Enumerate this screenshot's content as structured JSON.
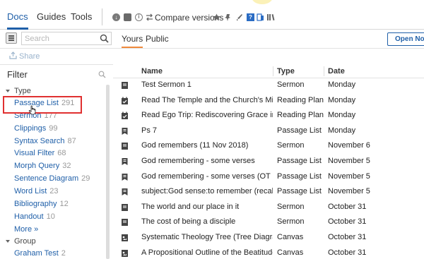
{
  "top_tabs": [
    {
      "label": "Docs",
      "active": true
    },
    {
      "label": "Guides",
      "active": false
    },
    {
      "label": "Tools",
      "active": false
    }
  ],
  "toolbar": {
    "compare_label": "Compare versions",
    "icons": [
      "download-icon",
      "panel-icon",
      "info-icon",
      "compare-icon",
      "star-icon",
      "pin-icon",
      "brush-icon",
      "help-icon",
      "bookmark-icon",
      "library-icon"
    ]
  },
  "search": {
    "placeholder": "Search",
    "value": ""
  },
  "sub_tabs": [
    {
      "label": "Yours",
      "active": true
    },
    {
      "label": "Public",
      "active": false
    }
  ],
  "open_notes_label": "Open Notes",
  "share_label": "Share",
  "filter": {
    "title": "Filter",
    "type_group_label": "Type",
    "type_items": [
      {
        "label": "Passage List",
        "count": "291"
      },
      {
        "label": "Sermon",
        "count": "177"
      },
      {
        "label": "Clippings",
        "count": "99"
      },
      {
        "label": "Syntax Search",
        "count": "87"
      },
      {
        "label": "Visual Filter",
        "count": "68"
      },
      {
        "label": "Morph Query",
        "count": "32"
      },
      {
        "label": "Sentence Diagram",
        "count": "29"
      },
      {
        "label": "Word List",
        "count": "23"
      },
      {
        "label": "Bibliography",
        "count": "12"
      },
      {
        "label": "Handout",
        "count": "10"
      }
    ],
    "more_label": "More »",
    "group_label": "Group",
    "group_items": [
      {
        "label": "Graham Test",
        "count": "2"
      }
    ]
  },
  "table": {
    "columns": [
      "Name",
      "Type",
      "Date"
    ],
    "rows": [
      {
        "icon": "sermon-icon",
        "name": "Test Sermon 1",
        "type": "Sermon",
        "date": "Monday"
      },
      {
        "icon": "reading-plan-icon",
        "name": "Read The Temple and the Church's Missi...",
        "type": "Reading Plan",
        "date": "Monday"
      },
      {
        "icon": "reading-plan-icon",
        "name": "Read Ego Trip: Rediscovering Grace in a...",
        "type": "Reading Plan",
        "date": "Monday"
      },
      {
        "icon": "passage-list-icon",
        "name": "Ps 7",
        "type": "Passage List",
        "date": "Monday"
      },
      {
        "icon": "sermon-icon",
        "name": "God remembers (11 Nov 2018)",
        "type": "Sermon",
        "date": "November 6"
      },
      {
        "icon": "passage-list-icon",
        "name": "God remembering - some verses",
        "type": "Passage List",
        "date": "November 5"
      },
      {
        "icon": "passage-list-icon",
        "name": "God remembering - some verses (OT an...",
        "type": "Passage List",
        "date": "November 5"
      },
      {
        "icon": "passage-list-icon",
        "name": "subject:God sense:to remember (recall) i...",
        "type": "Passage List",
        "date": "November 5"
      },
      {
        "icon": "sermon-icon",
        "name": "The world and our place in it",
        "type": "Sermon",
        "date": "October 31"
      },
      {
        "icon": "sermon-icon",
        "name": "The cost of being a disciple",
        "type": "Sermon",
        "date": "October 31"
      },
      {
        "icon": "canvas-icon",
        "name": "Systematic Theology Tree (Tree Diagram)",
        "type": "Canvas",
        "date": "October 31"
      },
      {
        "icon": "canvas-icon",
        "name": "A Propositional Outline of the Beatitude...",
        "type": "Canvas",
        "date": "October 31"
      }
    ]
  },
  "colors": {
    "accent": "#1f5fa8",
    "active_subtab": "#f08a3c",
    "highlight_box": "#e03030"
  }
}
